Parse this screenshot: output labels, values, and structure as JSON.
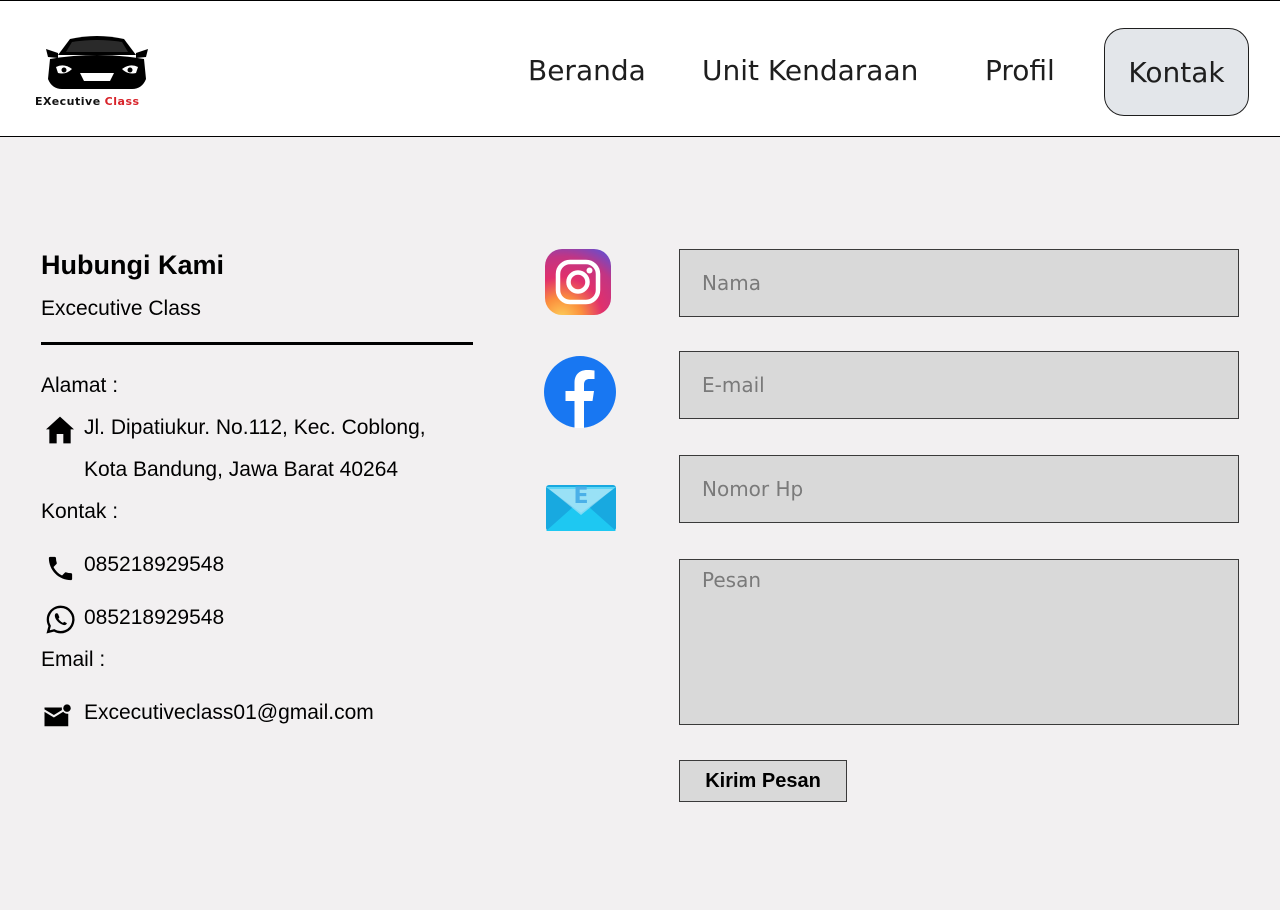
{
  "brand": {
    "logo_word1": "EXecutive",
    "logo_word2": "Class",
    "logo_icon": "car-front-icon",
    "accent_color": "#d8232a"
  },
  "nav": {
    "items": [
      {
        "label": "Beranda"
      },
      {
        "label": "Unit Kendaraan"
      },
      {
        "label": "Profil"
      },
      {
        "label": "Kontak",
        "active": true
      }
    ]
  },
  "contact": {
    "title": "Hubungi Kami",
    "subtitle": "Excecutive Class",
    "address_label": "Alamat :",
    "address_line1": "Jl. Dipatiukur. No.112, Kec. Coblong,",
    "address_line2": "Kota Bandung, Jawa Barat 40264",
    "contact_label": "Kontak :",
    "phone": "085218929548",
    "whatsapp": "085218929548",
    "email_label": "Email :",
    "email": "Excecutiveclass01@gmail.com"
  },
  "social": [
    {
      "icon": "instagram-icon"
    },
    {
      "icon": "facebook-icon"
    },
    {
      "icon": "email-app-icon"
    }
  ],
  "form": {
    "name_placeholder": "Nama",
    "email_placeholder": "E-mail",
    "phone_placeholder": "Nomor Hp",
    "message_placeholder": "Pesan",
    "submit_label": "Kirim Pesan"
  },
  "colors": {
    "page_bg": "#f2f0f1",
    "header_bg": "#ffffff",
    "input_bg": "#d9d9d9",
    "nav_active_bg": "#e3e6ea",
    "facebook_blue": "#1877f2",
    "mail_icon_blue": "#1ec8f2"
  }
}
